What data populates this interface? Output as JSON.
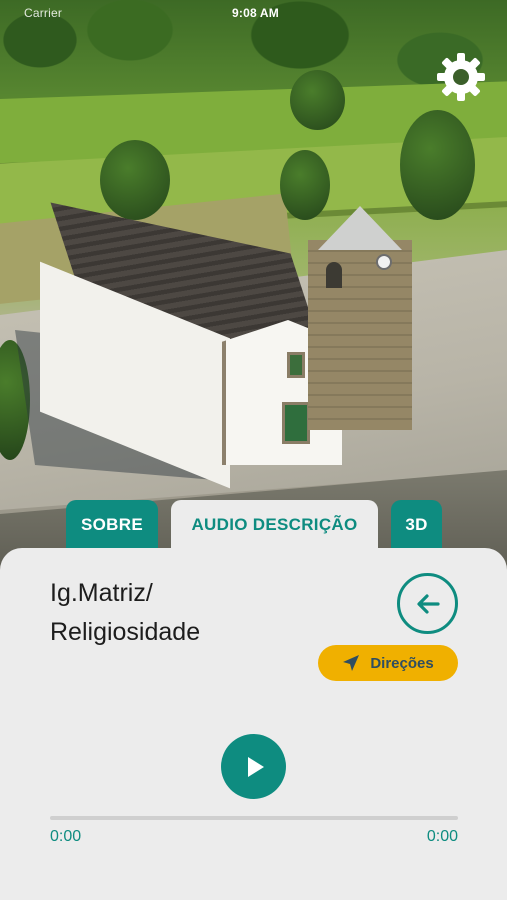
{
  "status_bar": {
    "carrier": "Carrier",
    "time": "9:08 AM"
  },
  "hero": {
    "image_subject": "aerial photo of church"
  },
  "settings": {
    "icon": "gear-icon"
  },
  "tabs": [
    {
      "label": "SOBRE",
      "active": false
    },
    {
      "label": "AUDIO DESCRIÇÃO",
      "active": true
    },
    {
      "label": "3D",
      "active": false
    }
  ],
  "place": {
    "title": "Ig.Matriz/\nReligiosidade"
  },
  "actions": {
    "back_icon": "arrow-left-icon",
    "directions_label": "Direções",
    "directions_icon": "navigation-arrow-icon"
  },
  "player": {
    "play_icon": "play-icon",
    "current_time": "0:00",
    "duration": "0:00",
    "progress": 0
  },
  "colors": {
    "accent": "#0e8c80",
    "directions": "#f0b000",
    "panel": "#ececec",
    "text": "#1d1d1d"
  }
}
